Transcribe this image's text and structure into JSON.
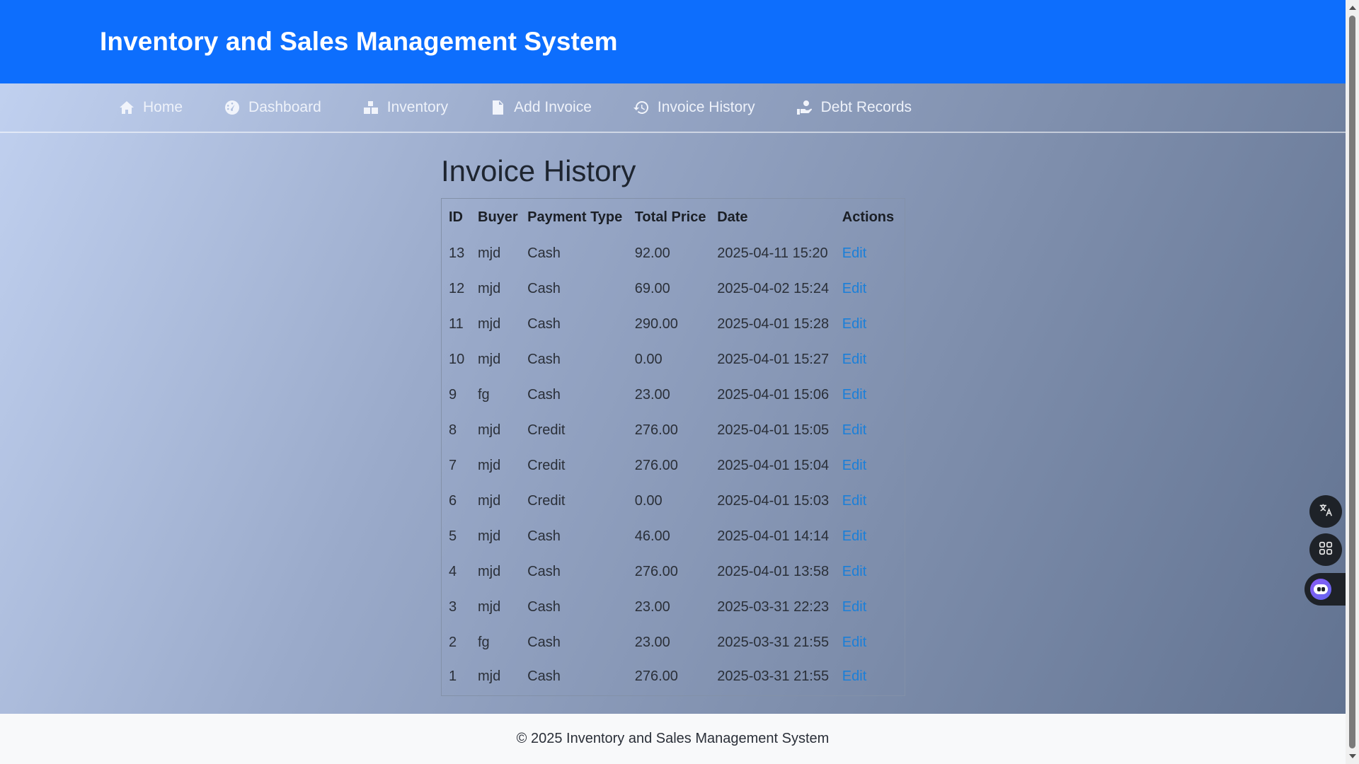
{
  "app": {
    "title": "Inventory and Sales Management System"
  },
  "nav": {
    "items": [
      {
        "label": "Home",
        "icon": "home-icon"
      },
      {
        "label": "Dashboard",
        "icon": "gauge-icon"
      },
      {
        "label": "Inventory",
        "icon": "boxes-icon"
      },
      {
        "label": "Add Invoice",
        "icon": "invoice-icon"
      },
      {
        "label": "Invoice History",
        "icon": "history-icon"
      },
      {
        "label": "Debt Records",
        "icon": "hand-coin-icon"
      }
    ]
  },
  "page": {
    "title": "Invoice History"
  },
  "table": {
    "headers": [
      "ID",
      "Buyer",
      "Payment Type",
      "Total Price",
      "Date",
      "Actions"
    ],
    "action_label": "Edit",
    "rows": [
      {
        "id": "13",
        "buyer": "mjd",
        "payment": "Cash",
        "total": "92.00",
        "date": "2025-04-11 15:20"
      },
      {
        "id": "12",
        "buyer": "mjd",
        "payment": "Cash",
        "total": "69.00",
        "date": "2025-04-02 15:24"
      },
      {
        "id": "11",
        "buyer": "mjd",
        "payment": "Cash",
        "total": "290.00",
        "date": "2025-04-01 15:28"
      },
      {
        "id": "10",
        "buyer": "mjd",
        "payment": "Cash",
        "total": "0.00",
        "date": "2025-04-01 15:27"
      },
      {
        "id": "9",
        "buyer": "fg",
        "payment": "Cash",
        "total": "23.00",
        "date": "2025-04-01 15:06"
      },
      {
        "id": "8",
        "buyer": "mjd",
        "payment": "Credit",
        "total": "276.00",
        "date": "2025-04-01 15:05"
      },
      {
        "id": "7",
        "buyer": "mjd",
        "payment": "Credit",
        "total": "276.00",
        "date": "2025-04-01 15:04"
      },
      {
        "id": "6",
        "buyer": "mjd",
        "payment": "Credit",
        "total": "0.00",
        "date": "2025-04-01 15:03"
      },
      {
        "id": "5",
        "buyer": "mjd",
        "payment": "Cash",
        "total": "46.00",
        "date": "2025-04-01 14:14"
      },
      {
        "id": "4",
        "buyer": "mjd",
        "payment": "Cash",
        "total": "276.00",
        "date": "2025-04-01 13:58"
      },
      {
        "id": "3",
        "buyer": "mjd",
        "payment": "Cash",
        "total": "23.00",
        "date": "2025-03-31 22:23"
      },
      {
        "id": "2",
        "buyer": "fg",
        "payment": "Cash",
        "total": "23.00",
        "date": "2025-03-31 21:55"
      },
      {
        "id": "1",
        "buyer": "mjd",
        "payment": "Cash",
        "total": "276.00",
        "date": "2025-03-31 21:55"
      }
    ]
  },
  "footer": {
    "text": "© 2025 Inventory and Sales Management System"
  },
  "colors": {
    "header_bg": "#0d6efd",
    "link": "#1a7fd9",
    "footer_bg": "#f8f9fa"
  },
  "floating": {
    "icons": [
      "translate-icon",
      "apps-grid-icon",
      "assistant-bot-icon"
    ]
  }
}
